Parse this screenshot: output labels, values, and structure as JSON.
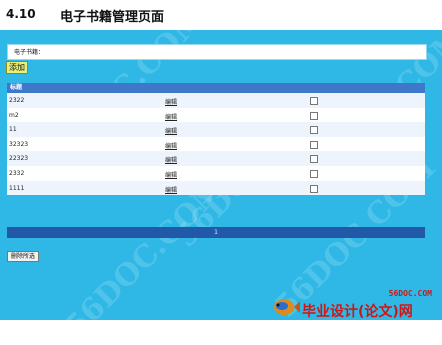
{
  "heading": {
    "section_number": "4.10",
    "section_title": "电子书籍管理页面"
  },
  "form": {
    "label": "电子书籍："
  },
  "toolbar": {
    "add_label": "添加",
    "delete_selected_label": "删除所选"
  },
  "table": {
    "header": "标题",
    "rows": [
      {
        "title": "2322",
        "edit": "编辑"
      },
      {
        "title": "m2",
        "edit": "编辑"
      },
      {
        "title": "11",
        "edit": "编辑"
      },
      {
        "title": "32323",
        "edit": "编辑"
      },
      {
        "title": "22323",
        "edit": "编辑"
      },
      {
        "title": "2332",
        "edit": "编辑"
      },
      {
        "title": "1111",
        "edit": "编辑"
      }
    ],
    "page": "1"
  },
  "watermark": {
    "text": "56DOC.COM",
    "logo_url": "56DOC.COM",
    "logo_text": "毕业设计(论文)网"
  },
  "colors": {
    "background": "#2fb8e6",
    "table_header": "#3f78c9",
    "pager": "#2159a8",
    "logo_red": "#d11414"
  }
}
